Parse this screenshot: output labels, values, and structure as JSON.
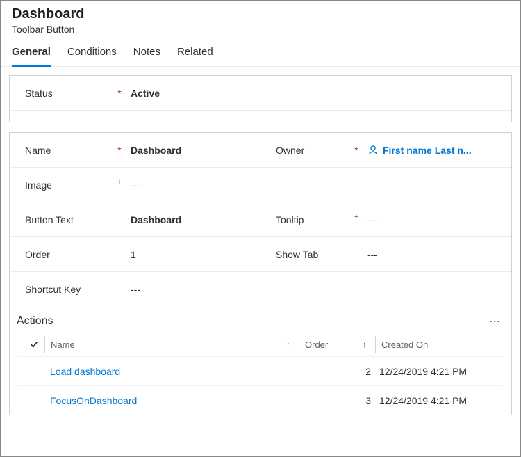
{
  "header": {
    "title": "Dashboard",
    "subtitle": "Toolbar Button"
  },
  "tabs": [
    "General",
    "Conditions",
    "Notes",
    "Related"
  ],
  "status": {
    "label": "Status",
    "value": "Active"
  },
  "fields": {
    "name": {
      "label": "Name",
      "value": "Dashboard"
    },
    "owner": {
      "label": "Owner",
      "value": "First name Last n..."
    },
    "image": {
      "label": "Image",
      "value": "---"
    },
    "buttonText": {
      "label": "Button Text",
      "value": "Dashboard"
    },
    "tooltip": {
      "label": "Tooltip",
      "value": "---"
    },
    "order": {
      "label": "Order",
      "value": "1"
    },
    "showTab": {
      "label": "Show Tab",
      "value": "---"
    },
    "shortcutKey": {
      "label": "Shortcut Key",
      "value": "---"
    }
  },
  "actions": {
    "title": "Actions",
    "columns": {
      "name": "Name",
      "order": "Order",
      "created": "Created On"
    },
    "rows": [
      {
        "name": "Load dashboard",
        "order": "2",
        "created": "12/24/2019 4:21 PM"
      },
      {
        "name": "FocusOnDashboard",
        "order": "3",
        "created": "12/24/2019 4:21 PM"
      }
    ]
  }
}
